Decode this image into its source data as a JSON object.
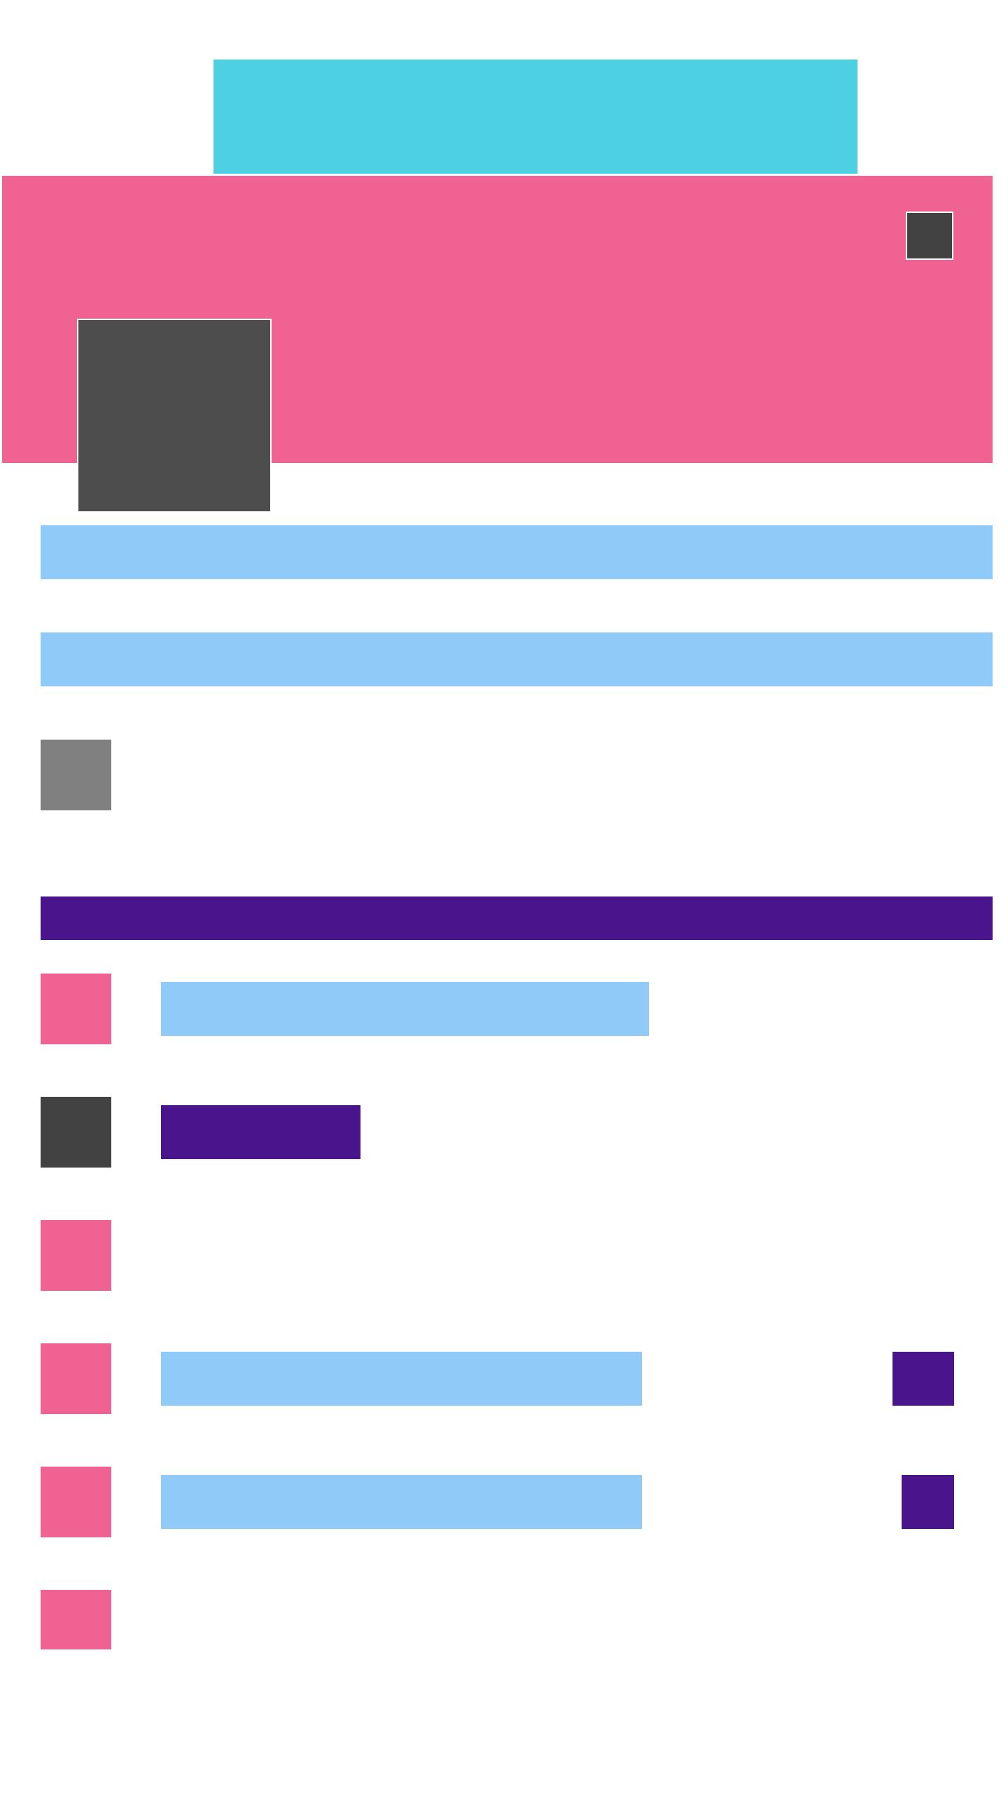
{
  "theme": {
    "banner": "#4dd0e1",
    "cover": "#f06292",
    "dark": "#4d4d4d",
    "darker": "#424242",
    "light_blue": "#90caf9",
    "gray": "#808080",
    "purple": "#4a148c",
    "pink": "#f06292"
  },
  "icons": {
    "corner": "more-icon",
    "profile": "avatar-image",
    "tile": "image-icon"
  },
  "list": {
    "rows": [
      {
        "icon_color": "#f06292",
        "has_text": true,
        "has_action": false
      },
      {
        "icon_color": "#424242",
        "has_text": true,
        "has_action": false
      },
      {
        "icon_color": "#f06292",
        "has_text": false,
        "has_action": false
      },
      {
        "icon_color": "#f06292",
        "has_text": true,
        "has_action": true
      },
      {
        "icon_color": "#f06292",
        "has_text": true,
        "has_action": true
      },
      {
        "icon_color": "#f06292",
        "has_text": false,
        "has_action": false
      }
    ]
  }
}
